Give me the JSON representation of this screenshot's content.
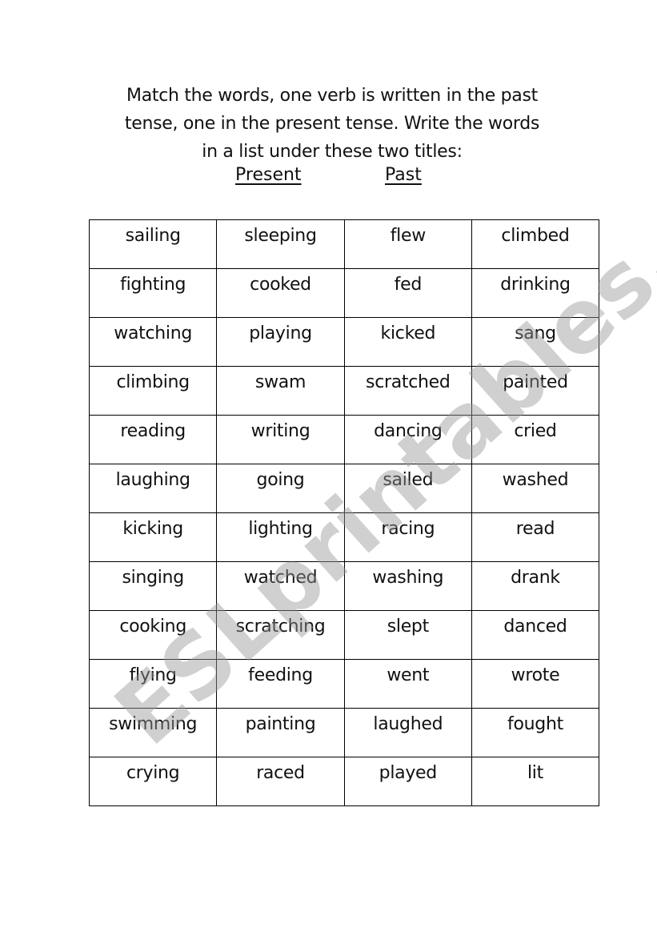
{
  "instructions": {
    "line1": "Match the words, one verb is written in the past",
    "line2": "tense, one in the present tense. Write the words",
    "line3": "in a list under these two titles:"
  },
  "titles": {
    "present": "Present",
    "past": "Past"
  },
  "table": {
    "rows": [
      [
        "sailing",
        "sleeping",
        "flew",
        "climbed"
      ],
      [
        "fighting",
        "cooked",
        "fed",
        "drinking"
      ],
      [
        "watching",
        "playing",
        "kicked",
        "sang"
      ],
      [
        "climbing",
        "swam",
        "scratched",
        "painted"
      ],
      [
        "reading",
        "writing",
        "dancing",
        "cried"
      ],
      [
        "laughing",
        "going",
        "sailed",
        "washed"
      ],
      [
        "kicking",
        "lighting",
        "racing",
        "read"
      ],
      [
        "singing",
        "watched",
        "washing",
        "drank"
      ],
      [
        "cooking",
        "scratching",
        "slept",
        "danced"
      ],
      [
        "flying",
        "feeding",
        "went",
        "wrote"
      ],
      [
        "swimming",
        "painting",
        "laughed",
        "fought"
      ],
      [
        "crying",
        "raced",
        "played",
        "lit"
      ]
    ]
  },
  "watermark": "ESLprintables.com"
}
